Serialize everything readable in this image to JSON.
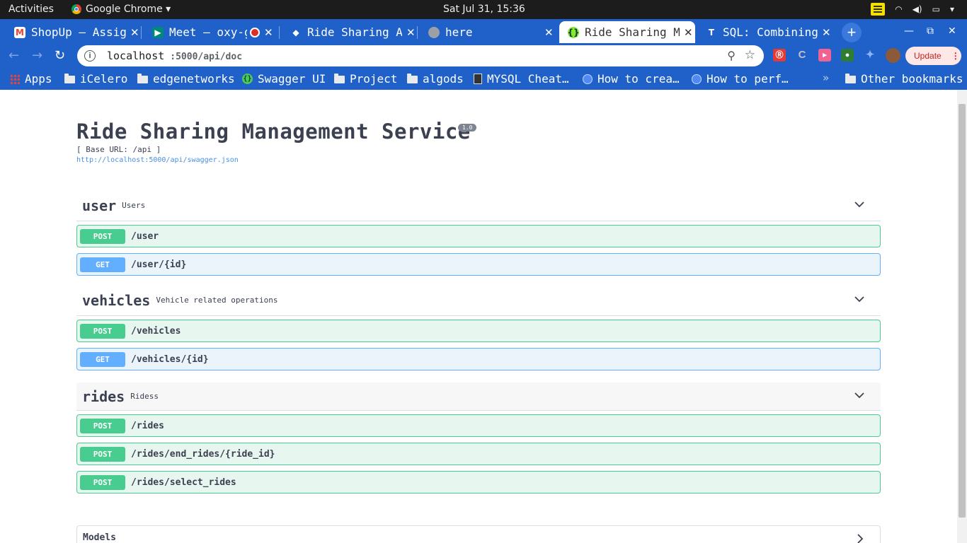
{
  "system_bar": {
    "activities": "Activities",
    "app_name": "Google Chrome ▾",
    "clock": "Sat Jul 31, 15:36"
  },
  "tabs": [
    {
      "title": "ShopUp – Assign",
      "favicon": "gmail-icon",
      "active": false
    },
    {
      "title": "Meet – oxy-g",
      "favicon": "meet-icon",
      "active": false
    },
    {
      "title": "Ride Sharing Ap",
      "favicon": "layers-icon",
      "active": false
    },
    {
      "title": "here",
      "favicon": "globe-icon",
      "active": false
    },
    {
      "title": "Ride Sharing Ma",
      "favicon": "swagger-icon",
      "active": true
    },
    {
      "title": "SQL: Combining",
      "favicon": "t-icon",
      "active": false
    }
  ],
  "toolbar": {
    "url_host": "localhost",
    "url_path": ":5000/api/doc",
    "update_label": "Update"
  },
  "bookmarks": [
    {
      "label": "Apps",
      "icon": "apps-grid-icon"
    },
    {
      "label": "iCelero",
      "icon": "folder-icon"
    },
    {
      "label": "edgenetworks",
      "icon": "folder-icon"
    },
    {
      "label": "Swagger UI",
      "icon": "swagger-icon"
    },
    {
      "label": "Project",
      "icon": "folder-icon"
    },
    {
      "label": "algods",
      "icon": "folder-icon"
    },
    {
      "label": "MYSQL Cheat…",
      "icon": "page-icon"
    },
    {
      "label": "How to crea…",
      "icon": "globe-icon"
    },
    {
      "label": "How to perf…",
      "icon": "globe-icon"
    },
    {
      "label": "Other bookmarks",
      "icon": "folder-icon"
    }
  ],
  "api": {
    "title": "Ride Sharing Management Service",
    "version": "1.0",
    "base_url": "[ Base URL: /api ]",
    "spec_link": "http://localhost:5000/api/swagger.json"
  },
  "sections": [
    {
      "name": "user",
      "description": "Users",
      "operations": [
        {
          "method": "POST",
          "path": "/user"
        },
        {
          "method": "GET",
          "path": "/user/{id}"
        }
      ]
    },
    {
      "name": "vehicles",
      "description": "Vehicle related operations",
      "operations": [
        {
          "method": "POST",
          "path": "/vehicles"
        },
        {
          "method": "GET",
          "path": "/vehicles/{id}"
        }
      ]
    },
    {
      "name": "rides",
      "description": "Ridess",
      "operations": [
        {
          "method": "POST",
          "path": "/rides"
        },
        {
          "method": "POST",
          "path": "/rides/end_rides/{ride_id}"
        },
        {
          "method": "POST",
          "path": "/rides/select_rides"
        }
      ]
    }
  ],
  "models_label": "Models",
  "colors": {
    "chrome_blue": "#1f60c9",
    "post": "#49cc90",
    "get": "#61affe",
    "text": "#3b4151"
  }
}
